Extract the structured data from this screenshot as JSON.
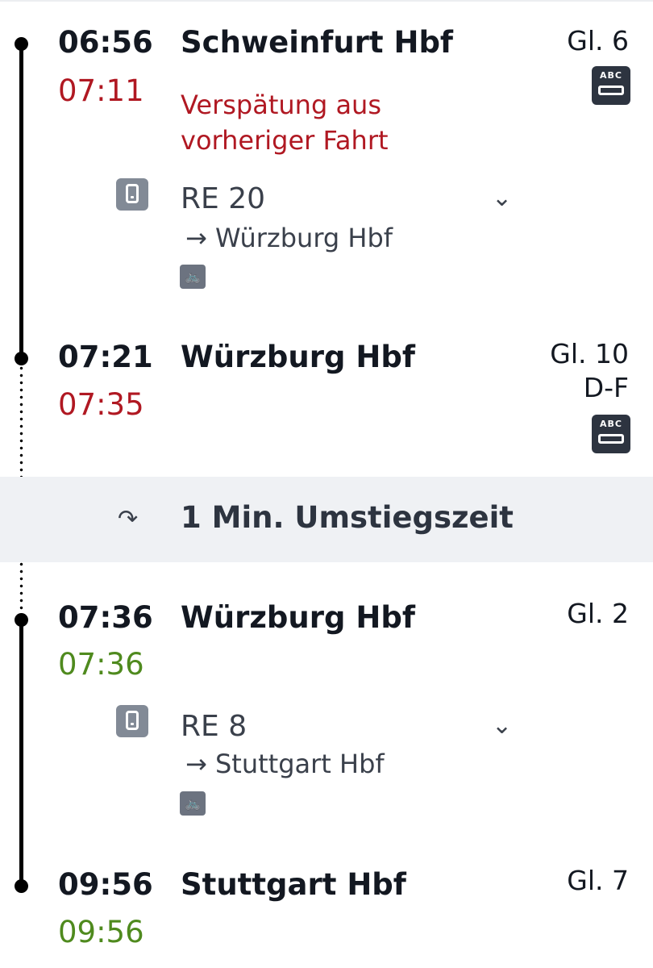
{
  "stops": [
    {
      "planned": "06:56",
      "actual": "07:11",
      "actual_status": "delayed",
      "station": "Schweinfurt Hbf",
      "platform": "Gl. 6",
      "note": "Verspätung aus vorheriger Fahrt",
      "platform_icon": "abc-bus-icon"
    },
    {
      "planned": "07:21",
      "actual": "07:35",
      "actual_status": "delayed",
      "station": "Würzburg Hbf",
      "platform_line1": "Gl. 10",
      "platform_line2": "D-F",
      "platform_icon": "abc-bus-icon"
    },
    {
      "planned": "07:36",
      "actual": "07:36",
      "actual_status": "on-time",
      "station": "Würzburg Hbf",
      "platform": "Gl. 2"
    },
    {
      "planned": "09:56",
      "actual": "09:56",
      "actual_status": "on-time",
      "station": "Stuttgart Hbf",
      "platform": "Gl. 7"
    }
  ],
  "legs": [
    {
      "train": "RE 20",
      "direction": "→ Würzburg Hbf",
      "mode_icon": "phone-ticket-icon",
      "bike_icon": "bicycle-icon",
      "expand_icon": "chevron-down-icon"
    },
    {
      "train": "RE 8",
      "direction": "→ Stuttgart Hbf",
      "mode_icon": "phone-ticket-icon",
      "bike_icon": "bicycle-icon",
      "expand_icon": "chevron-down-icon"
    }
  ],
  "transfer": {
    "text": "1 Min. Umstiegszeit",
    "icon": "transfer-arrow-icon"
  },
  "colors": {
    "delay": "#b01822",
    "on_time": "#4f8a1e",
    "transfer_band": "#eff1f4"
  }
}
